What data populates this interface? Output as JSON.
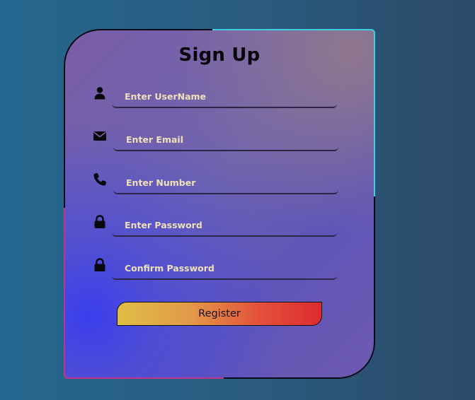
{
  "form": {
    "title": "Sign Up",
    "fields": [
      {
        "icon": "user-icon",
        "placeholder": "Enter UserName"
      },
      {
        "icon": "envelope-icon",
        "placeholder": "Enter Email"
      },
      {
        "icon": "phone-icon",
        "placeholder": "Enter Number"
      },
      {
        "icon": "lock-icon",
        "placeholder": "Enter Password"
      },
      {
        "icon": "lock-icon",
        "placeholder": "Confirm Password"
      }
    ],
    "submit_label": "Register"
  },
  "colors": {
    "page_background": "#27608a",
    "card_gradient_start": "#7a5ea6",
    "card_gradient_end": "#3c3ff0",
    "accent_cyan": "#3fd0e0",
    "accent_magenta": "#c0348f",
    "button_gradient_start": "#e0bd46",
    "button_gradient_end": "#de2b2e",
    "placeholder_text": "#efe0b8"
  }
}
